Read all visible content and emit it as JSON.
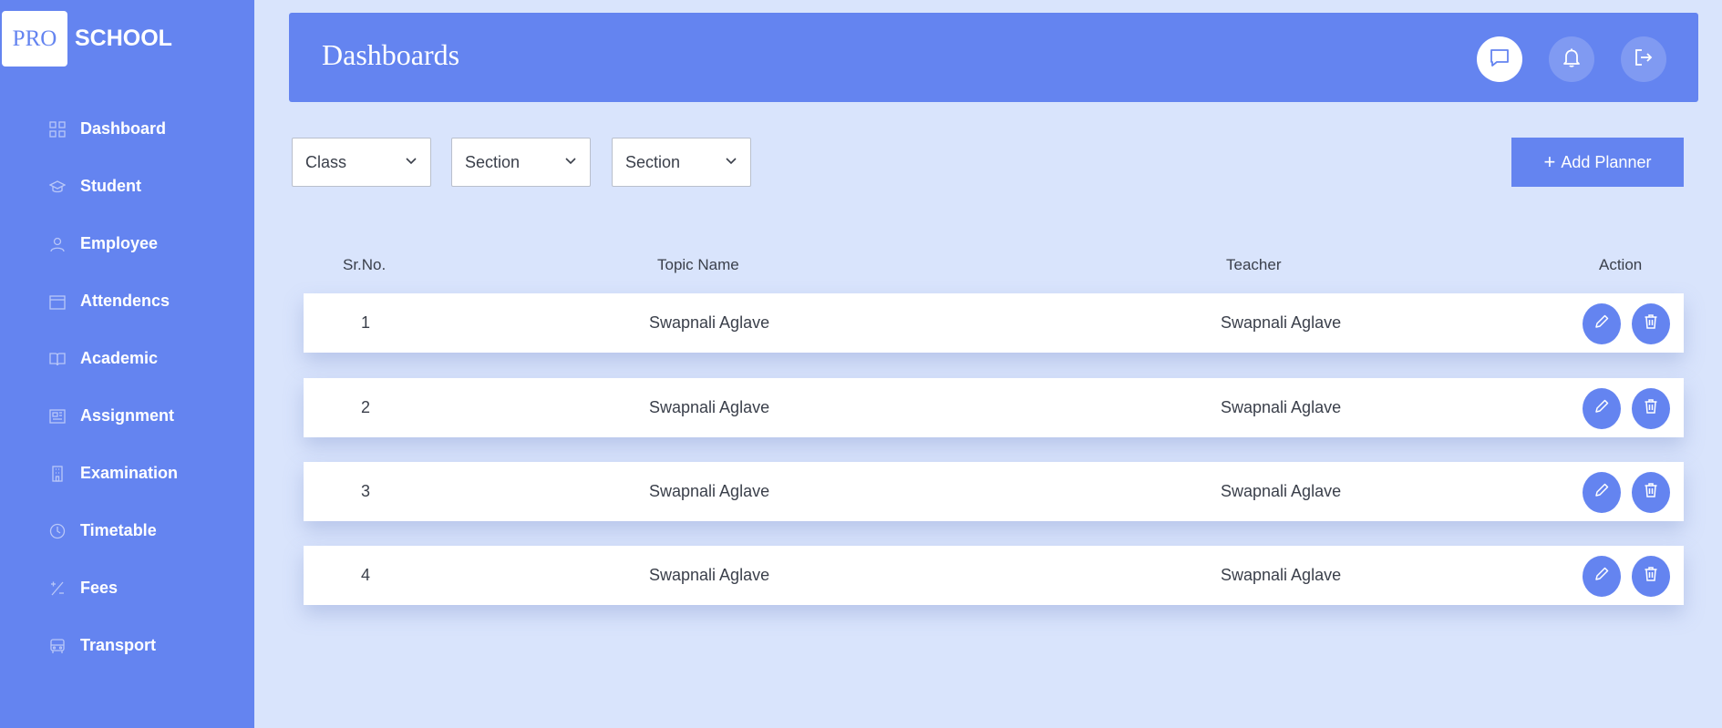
{
  "brand": {
    "logo_box": "PRO",
    "logo_text": "SCHOOL"
  },
  "sidebar": {
    "items": [
      {
        "label": "Dashboard",
        "icon": "grid-icon"
      },
      {
        "label": "Student",
        "icon": "graduation-cap-icon"
      },
      {
        "label": "Employee",
        "icon": "user-icon"
      },
      {
        "label": "Attendencs",
        "icon": "calendar-icon"
      },
      {
        "label": "Academic",
        "icon": "book-icon"
      },
      {
        "label": "Assignment",
        "icon": "newspaper-icon"
      },
      {
        "label": "Examination",
        "icon": "building-icon"
      },
      {
        "label": "Timetable",
        "icon": "clock-icon"
      },
      {
        "label": "Fees",
        "icon": "percent-icon"
      },
      {
        "label": "Transport",
        "icon": "bus-icon"
      }
    ]
  },
  "header": {
    "title": "Dashboards",
    "buttons": [
      "chat-icon",
      "bell-icon",
      "logout-icon"
    ]
  },
  "filters": {
    "class_label": "Class",
    "section_label": "Section",
    "section2_label": "Section"
  },
  "add_button": {
    "plus": "+",
    "label": "Add Planner"
  },
  "table": {
    "headers": {
      "sr": "Sr.No.",
      "topic": "Topic Name",
      "teacher": "Teacher",
      "action": "Action"
    },
    "rows": [
      {
        "sr": "1",
        "topic": "Swapnali Aglave",
        "teacher": "Swapnali Aglave"
      },
      {
        "sr": "2",
        "topic": "Swapnali Aglave",
        "teacher": "Swapnali Aglave"
      },
      {
        "sr": "3",
        "topic": "Swapnali Aglave",
        "teacher": "Swapnali Aglave"
      },
      {
        "sr": "4",
        "topic": "Swapnali Aglave",
        "teacher": "Swapnali Aglave"
      }
    ]
  },
  "colors": {
    "primary": "#6484f0",
    "background": "#d9e4fc",
    "text": "#3a3f4a"
  }
}
